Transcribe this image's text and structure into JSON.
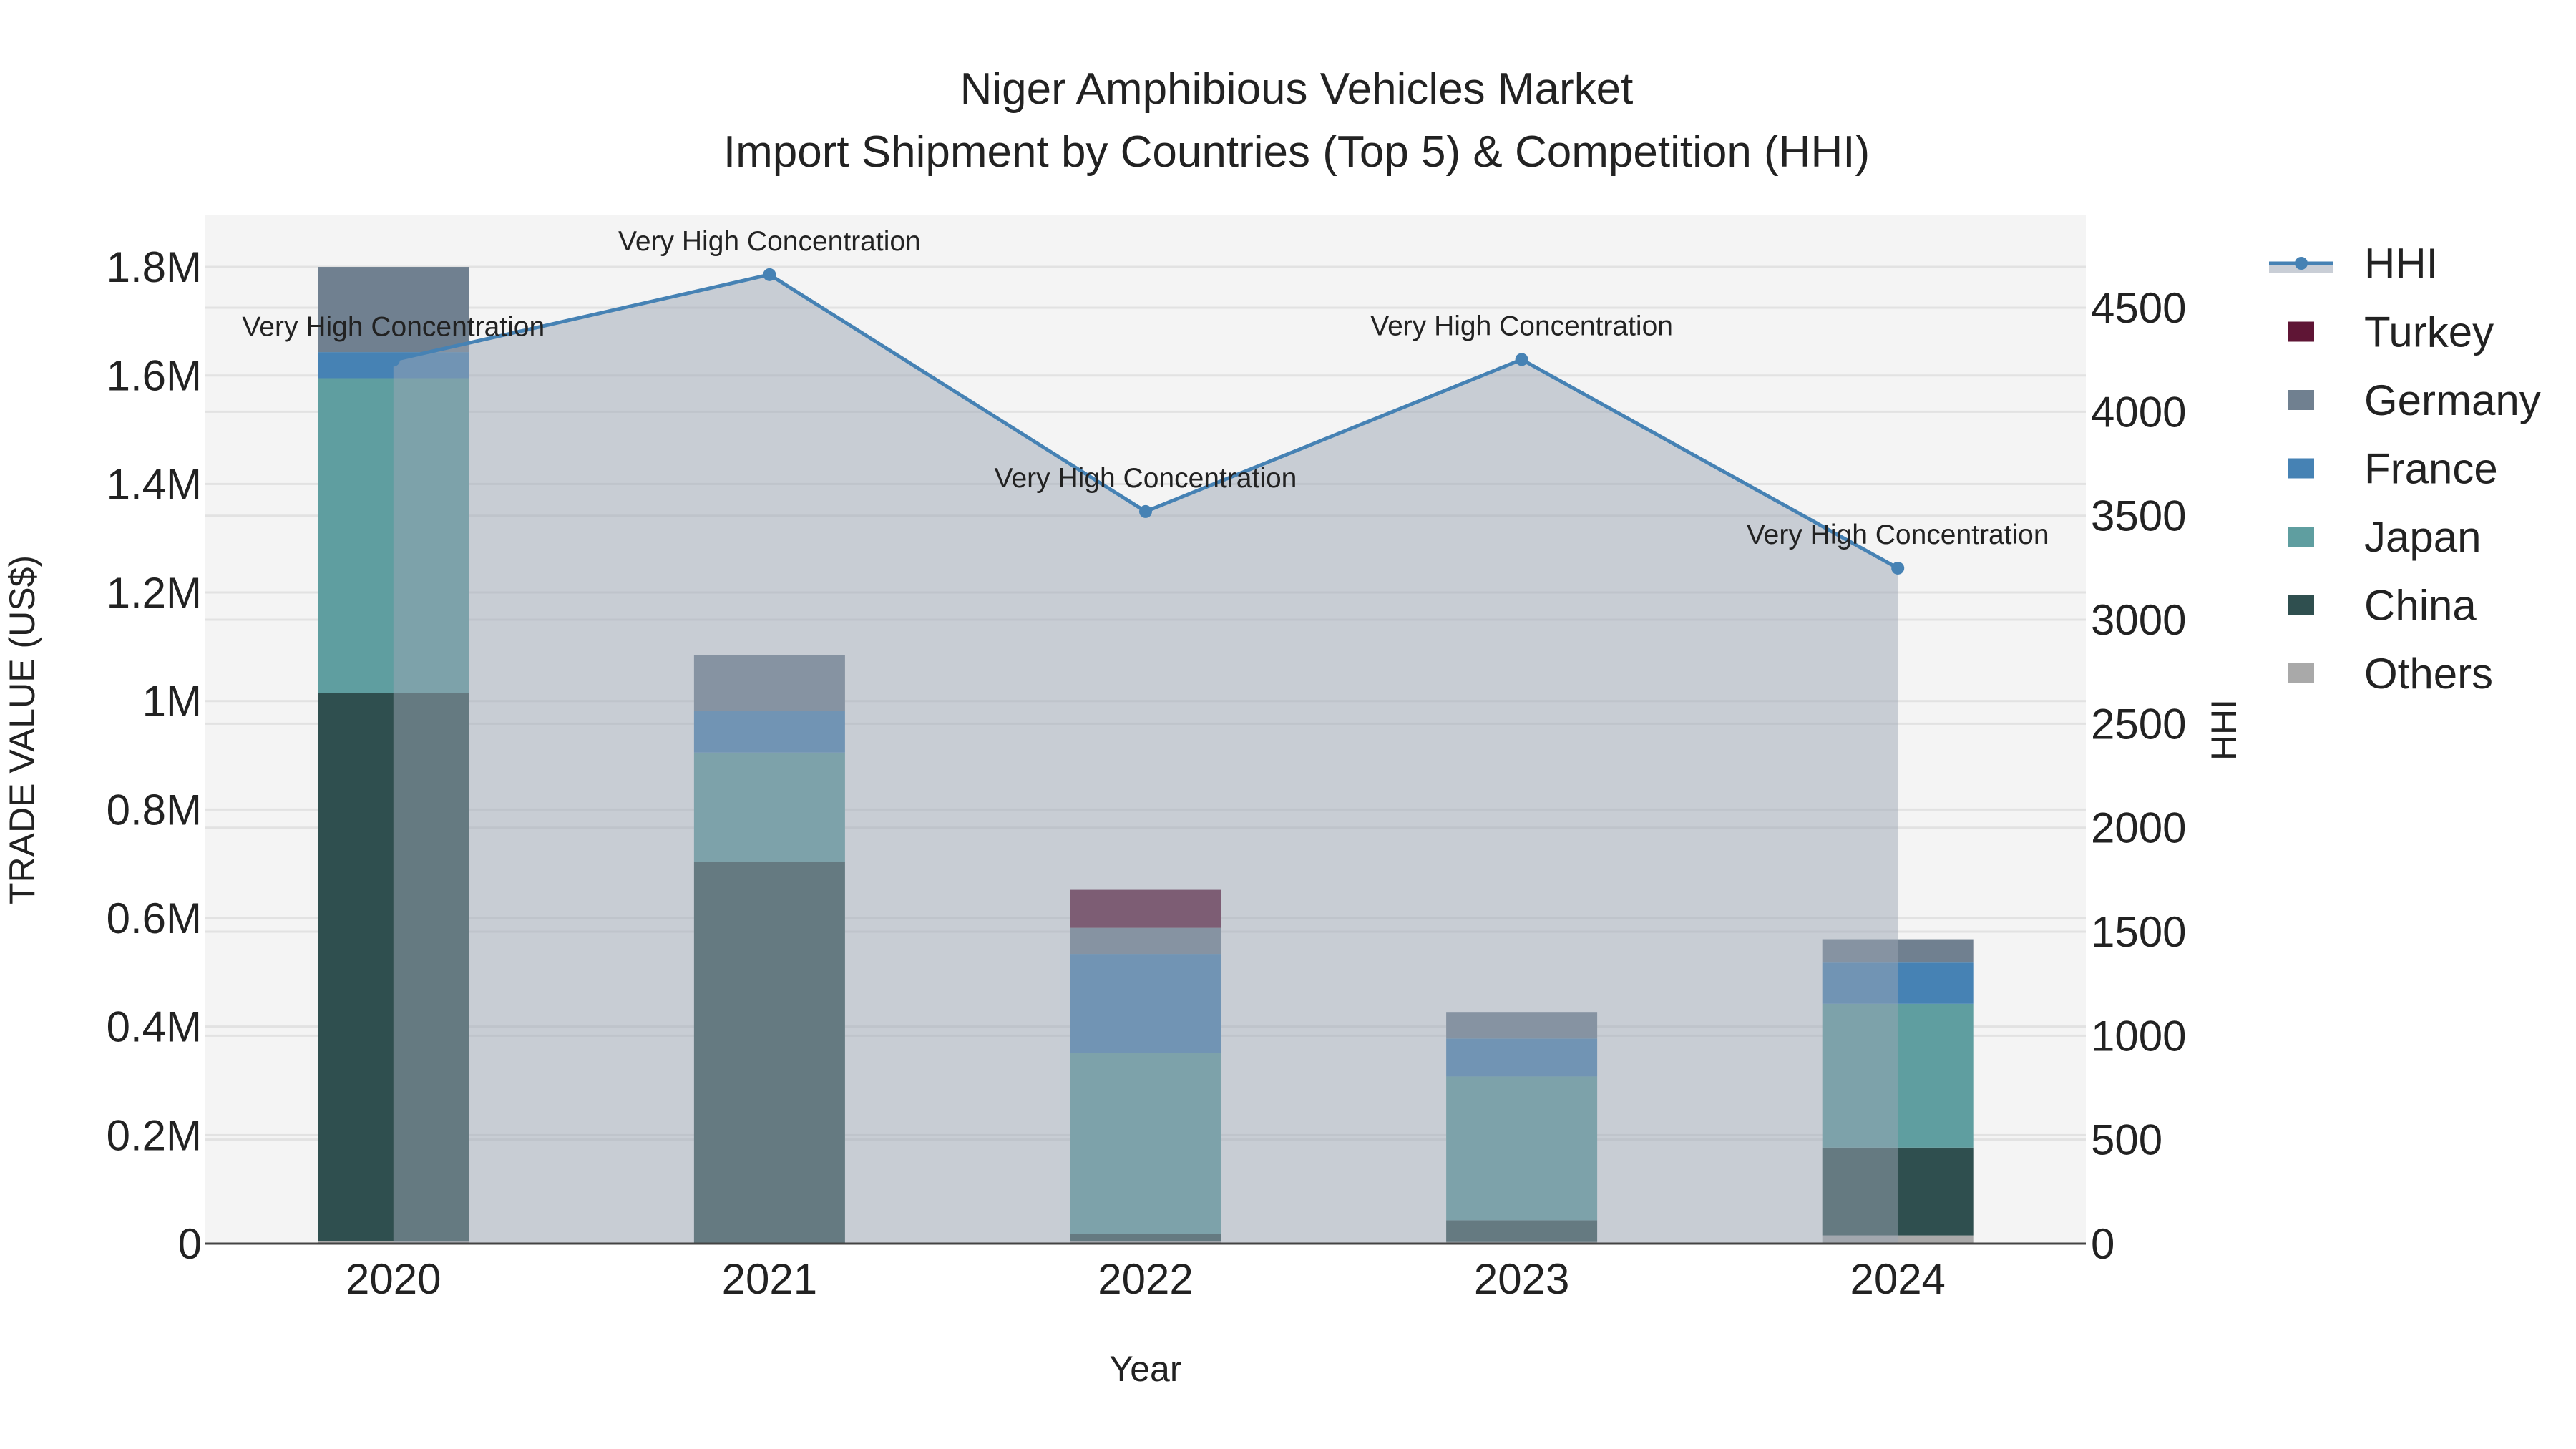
{
  "chart_data": {
    "type": "bar",
    "title": "Niger Amphibious Vehicles Market",
    "subtitle": "Import Shipment by Countries (Top 5) & Competition (HHI)",
    "xlabel": "Year",
    "ylabel": "TRADE VALUE (US$)",
    "y2label": "HHI",
    "categories": [
      "2020",
      "2021",
      "2022",
      "2023",
      "2024"
    ],
    "ylim": [
      0,
      1895000
    ],
    "y2lim": [
      0,
      4944
    ],
    "yticks": [
      {
        "value": 0,
        "label": "0"
      },
      {
        "value": 200000,
        "label": "0.2M"
      },
      {
        "value": 400000,
        "label": "0.4M"
      },
      {
        "value": 600000,
        "label": "0.6M"
      },
      {
        "value": 800000,
        "label": "0.8M"
      },
      {
        "value": 1000000,
        "label": "1M"
      },
      {
        "value": 1200000,
        "label": "1.2M"
      },
      {
        "value": 1400000,
        "label": "1.4M"
      },
      {
        "value": 1600000,
        "label": "1.6M"
      },
      {
        "value": 1800000,
        "label": "1.8M"
      }
    ],
    "y2ticks": [
      {
        "value": 0,
        "label": "0"
      },
      {
        "value": 500,
        "label": "500"
      },
      {
        "value": 1000,
        "label": "1000"
      },
      {
        "value": 1500,
        "label": "1500"
      },
      {
        "value": 2000,
        "label": "2000"
      },
      {
        "value": 2500,
        "label": "2500"
      },
      {
        "value": 3000,
        "label": "3000"
      },
      {
        "value": 3500,
        "label": "3500"
      },
      {
        "value": 4000,
        "label": "4000"
      },
      {
        "value": 4500,
        "label": "4500"
      }
    ],
    "grid": true,
    "legend_position": "right",
    "series": [
      {
        "name": "Others",
        "color": "#a9a9a9",
        "values": [
          5000,
          0,
          5000,
          3000,
          15000
        ]
      },
      {
        "name": "China",
        "color": "#2f4f4f",
        "values": [
          1010000,
          704000,
          13000,
          40000,
          162000
        ]
      },
      {
        "name": "Japan",
        "color": "#5f9ea0",
        "values": [
          580000,
          201000,
          333000,
          265000,
          265000
        ]
      },
      {
        "name": "France",
        "color": "#4682b4",
        "values": [
          48000,
          77000,
          183000,
          70000,
          76000
        ]
      },
      {
        "name": "Germany",
        "color": "#708090",
        "values": [
          157000,
          103000,
          48000,
          49000,
          43000
        ]
      },
      {
        "name": "Turkey",
        "color": "#5f1535",
        "values": [
          0,
          0,
          70000,
          0,
          0
        ]
      }
    ],
    "hhi": {
      "name": "HHI",
      "color": "#4682b4",
      "fill": "rgba(155,165,180,0.5)",
      "values": [
        4248,
        4659,
        3520,
        4251,
        3248
      ],
      "annotations": [
        "Very High Concentration",
        "Very High Concentration",
        "Very High Concentration",
        "Very High Concentration",
        "Very High Concentration"
      ]
    },
    "legend": [
      "HHI",
      "Turkey",
      "Germany",
      "France",
      "Japan",
      "China",
      "Others"
    ]
  }
}
